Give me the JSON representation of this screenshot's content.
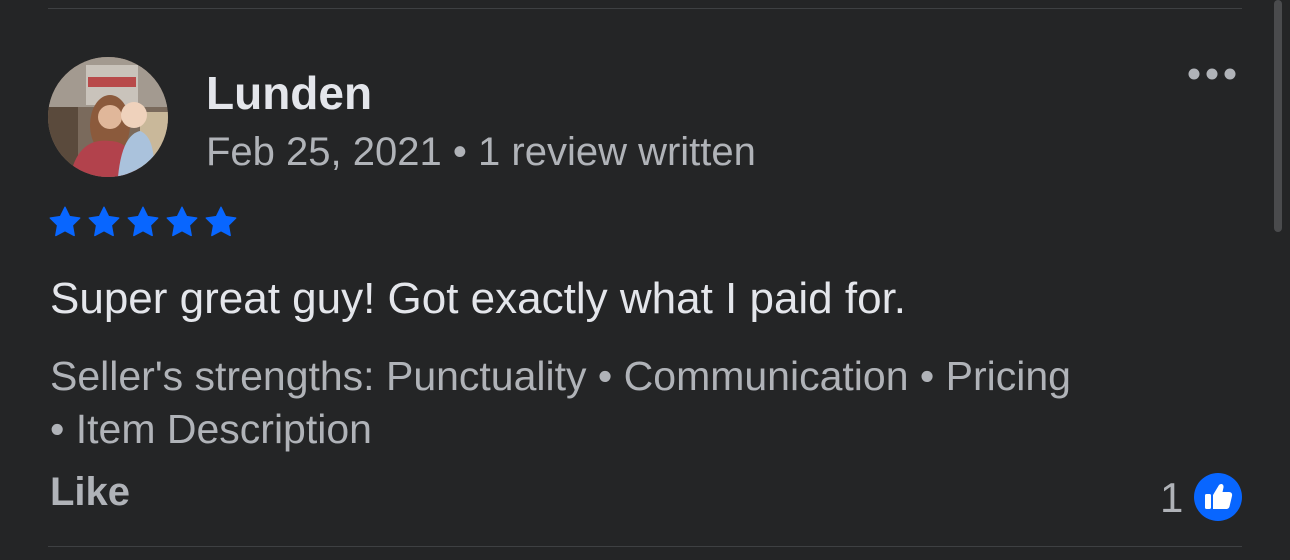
{
  "review": {
    "reviewer_name": "Lunden",
    "date": "Feb 25, 2021",
    "separator": "•",
    "reviews_written": "1 review written",
    "rating": 5,
    "text": "Super great guy! Got exactly what I paid for.",
    "strengths_line1": "Seller's strengths: Punctuality • Communication • Pricing",
    "strengths_line2": "• Item Description",
    "like_label": "Like",
    "like_count": "1"
  },
  "icons": {
    "avatar": "avatar-photo",
    "more": "more-horizontal-icon",
    "star": "star-icon",
    "like_badge": "thumbs-up-icon"
  },
  "colors": {
    "background": "#242526",
    "primary_text": "#e4e6eb",
    "secondary_text": "#b0b3b8",
    "accent_blue": "#0866ff",
    "divider": "#3e4042"
  }
}
